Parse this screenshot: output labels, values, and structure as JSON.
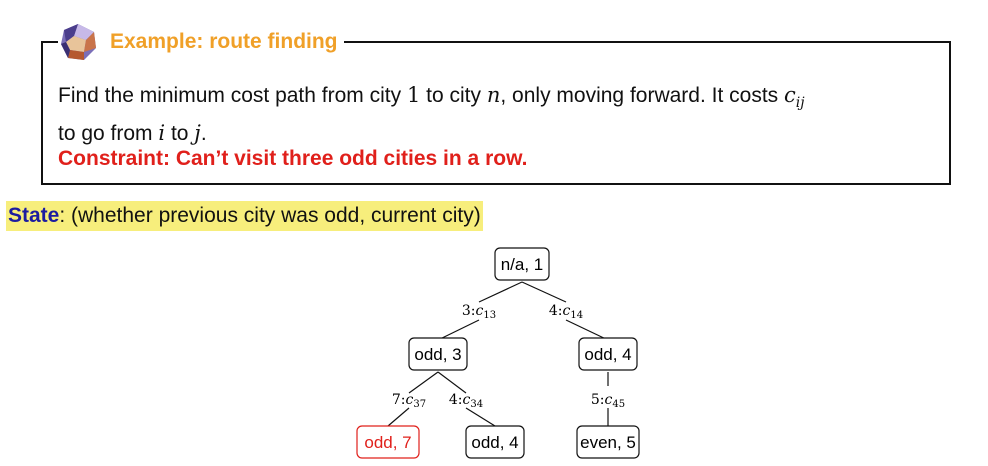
{
  "example": {
    "title": "Example: route finding",
    "problem_part1": "Find the minimum cost path from city ",
    "city_start": "1",
    "problem_part2": " to city ",
    "city_end": "n",
    "problem_part3": ", only moving forward. It costs ",
    "cost_base": "c",
    "cost_sub": "ij",
    "problem_part4": "to go from ",
    "from_var": "i",
    "problem_part5": " to ",
    "to_var": "j",
    "problem_part6": ".",
    "constraint": "Constraint: Can’t visit three odd cities in a row."
  },
  "state": {
    "label": "State",
    "description": ": (whether previous city was odd, current city)"
  },
  "tree": {
    "nodes": [
      {
        "id": "root",
        "text": "n/a, 1",
        "highlight": false
      },
      {
        "id": "odd3",
        "text": "odd, 3",
        "highlight": false
      },
      {
        "id": "odd4a",
        "text": "odd, 4",
        "highlight": false
      },
      {
        "id": "odd7",
        "text": "odd, 7",
        "highlight": true
      },
      {
        "id": "odd4b",
        "text": "odd, 4",
        "highlight": false
      },
      {
        "id": "even5",
        "text": "even, 5",
        "highlight": false
      }
    ],
    "edges": [
      {
        "id": "e13",
        "label": "3:",
        "cost": "c",
        "sub": "13"
      },
      {
        "id": "e14",
        "label": "4:",
        "cost": "c",
        "sub": "14"
      },
      {
        "id": "e37",
        "label": "7:",
        "cost": "c",
        "sub": "37"
      },
      {
        "id": "e34",
        "label": "4:",
        "cost": "c",
        "sub": "34"
      },
      {
        "id": "e45",
        "label": "5:",
        "cost": "c",
        "sub": "45"
      }
    ]
  },
  "colors": {
    "title_orange": "#f0a028",
    "constraint_red": "#e0201b",
    "state_blue": "#1c1ca0",
    "highlight_yellow": "#f7ee7c"
  },
  "icons": {
    "example_icon": "dodecahedron-icon"
  }
}
